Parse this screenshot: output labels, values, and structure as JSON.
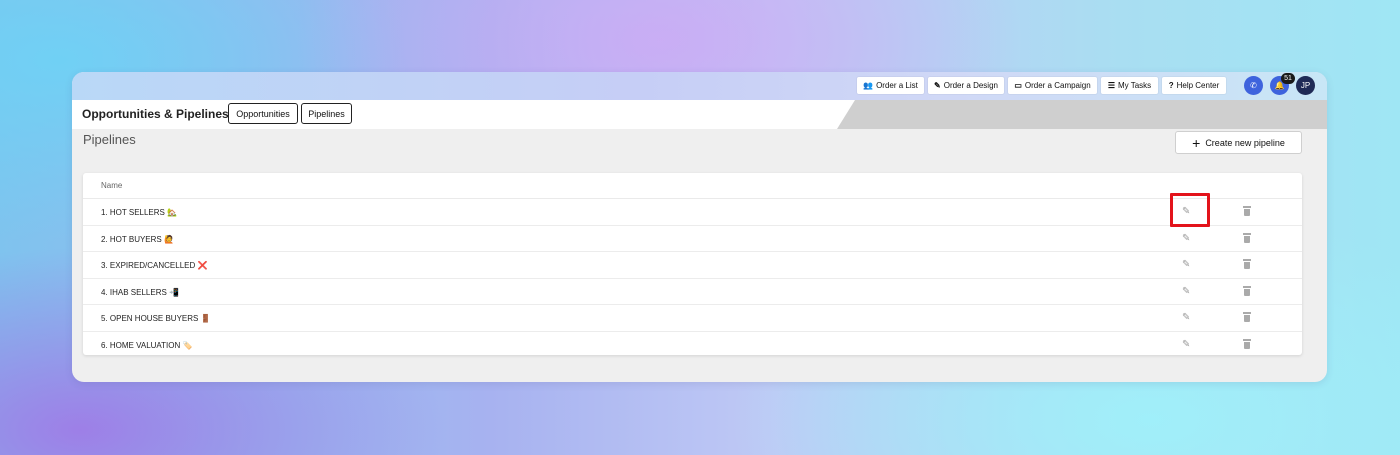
{
  "toolbar": {
    "order_list": "Order a List",
    "order_design": "Order a Design",
    "order_campaign": "Order a Campaign",
    "my_tasks": "My Tasks",
    "help_center": "Help Center"
  },
  "user": {
    "notifications_count": "51",
    "initials": "JP"
  },
  "header": {
    "title": "Opportunities & Pipelines",
    "tabs": [
      "Opportunities",
      "Pipelines"
    ]
  },
  "main": {
    "section_title": "Pipelines",
    "create_button": "Create new pipeline",
    "table": {
      "column_name": "Name",
      "rows": [
        "1. HOT SELLERS 🏡",
        "2. HOT BUYERS 🙋",
        "3. EXPIRED/CANCELLED ❌",
        "4. IHAB SELLERS 📲",
        "5. OPEN HOUSE BUYERS 🚪",
        "6. HOME VALUATION 🏷️"
      ]
    }
  },
  "colors": {
    "accent_blue": "#3e63dd",
    "avatar_navy": "#1f2a56",
    "highlight_red": "#e3131b"
  }
}
